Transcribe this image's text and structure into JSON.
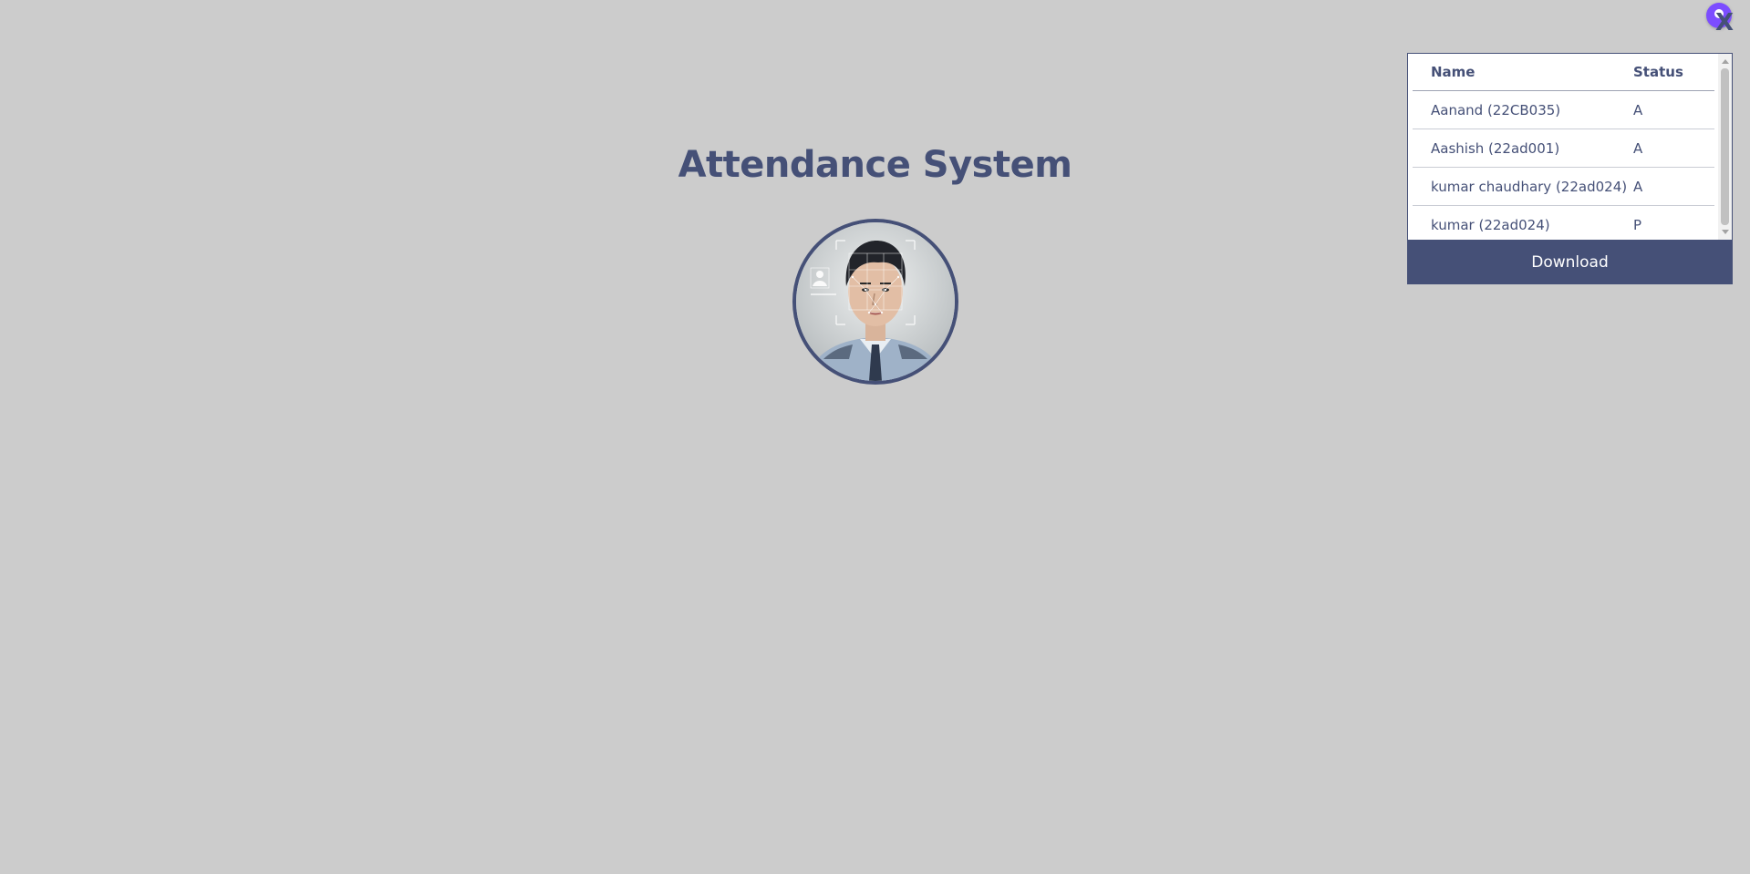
{
  "app": {
    "title": "Attendance System"
  },
  "header": {
    "close_label": "X",
    "user_icon": "user-avatar-icon"
  },
  "attendance": {
    "columns": [
      "Name",
      "Status"
    ],
    "rows": [
      {
        "name": "Aanand (22CB035)",
        "status": "A"
      },
      {
        "name": "Aashish (22ad001)",
        "status": "A"
      },
      {
        "name": "kumar chaudhary (22ad024)",
        "status": "A"
      },
      {
        "name": "kumar (22ad024)",
        "status": "P"
      }
    ],
    "download_label": "Download"
  },
  "colors": {
    "background": "#cccccc",
    "accent": "#455077",
    "user_icon": "#7c4dff"
  }
}
